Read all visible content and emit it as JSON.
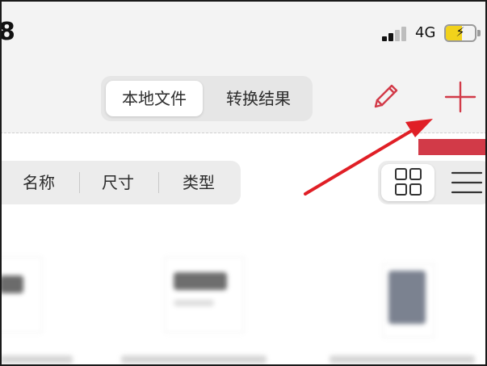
{
  "status_bar": {
    "time_fragment": "8",
    "network": "4G",
    "battery_level": 0.55,
    "battery_color": "#f2d21b"
  },
  "header": {
    "tabs": [
      {
        "label": "本地文件",
        "active": true
      },
      {
        "label": "转换结果",
        "active": false
      }
    ],
    "actions": [
      {
        "icon": "pencil-icon"
      },
      {
        "icon": "plus-icon"
      }
    ],
    "accent_color": "#d23a48"
  },
  "sort_bar": {
    "items": [
      {
        "label": "名称"
      },
      {
        "label": "尺寸"
      },
      {
        "label": "类型"
      }
    ]
  },
  "view_toggle": {
    "options": [
      {
        "icon": "grid-view-icon",
        "active": true
      },
      {
        "icon": "list-view-icon",
        "active": false
      }
    ]
  },
  "annotation": {
    "arrow_color": "#e01f26",
    "points_to": "plus-button"
  }
}
